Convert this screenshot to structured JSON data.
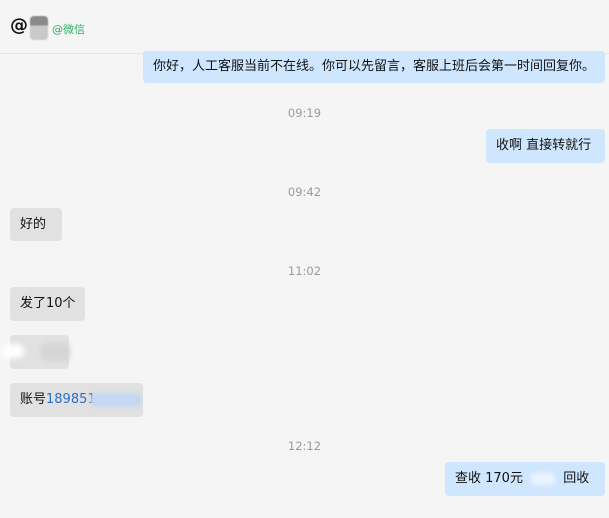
{
  "header": {
    "at_symbol": "@",
    "tag": "@微信"
  },
  "messages": [
    {
      "side": "right",
      "text": "你好，人工客服当前不在线。你可以先留言，客服上班后会第一时间回复你。"
    },
    {
      "time": "09:19"
    },
    {
      "side": "right",
      "text": "收啊  直接转就行"
    },
    {
      "time": "09:42"
    },
    {
      "side": "left",
      "text": "好的"
    },
    {
      "time": "11:02"
    },
    {
      "side": "left",
      "text": "发了10个"
    },
    {
      "side": "left",
      "text": ""
    },
    {
      "side": "left",
      "prefix": "账号",
      "link": "189851"
    },
    {
      "time": "12:12"
    },
    {
      "side": "right",
      "part1": "查收  170元",
      "part2": "回收"
    }
  ],
  "colors": {
    "bubble_right": "#cfe6ff",
    "bubble_left": "#e1e1e1",
    "wechat_green": "#2aae67",
    "link_blue": "#2a6fc9"
  }
}
